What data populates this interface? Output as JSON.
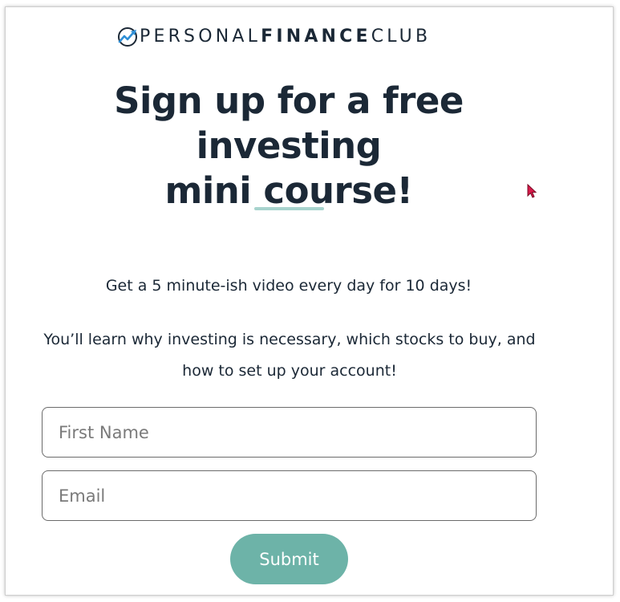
{
  "logo": {
    "part1": "PERSONAL",
    "part2": "FINANCE",
    "part3": "CLUB",
    "icon": "chart-arrow-logo-icon"
  },
  "headline": {
    "line1": "Sign up for a free investing",
    "line2": "mini course!"
  },
  "body": {
    "line1": "Get a 5 minute-ish video every day for 10 days!",
    "line2": "You’ll learn why investing is necessary, which stocks to buy, and how to set up your account!"
  },
  "form": {
    "first_name_placeholder": "First Name",
    "first_name_value": "",
    "email_placeholder": "Email",
    "email_value": "",
    "submit_label": "Submit"
  },
  "colors": {
    "text": "#1b2836",
    "accent": "#6db3a8",
    "divider": "#a7d3cd",
    "logo_blue": "#2f8fd6",
    "cursor": "#d81b4a"
  },
  "icons": {
    "cursor": "mouse-pointer-icon"
  }
}
